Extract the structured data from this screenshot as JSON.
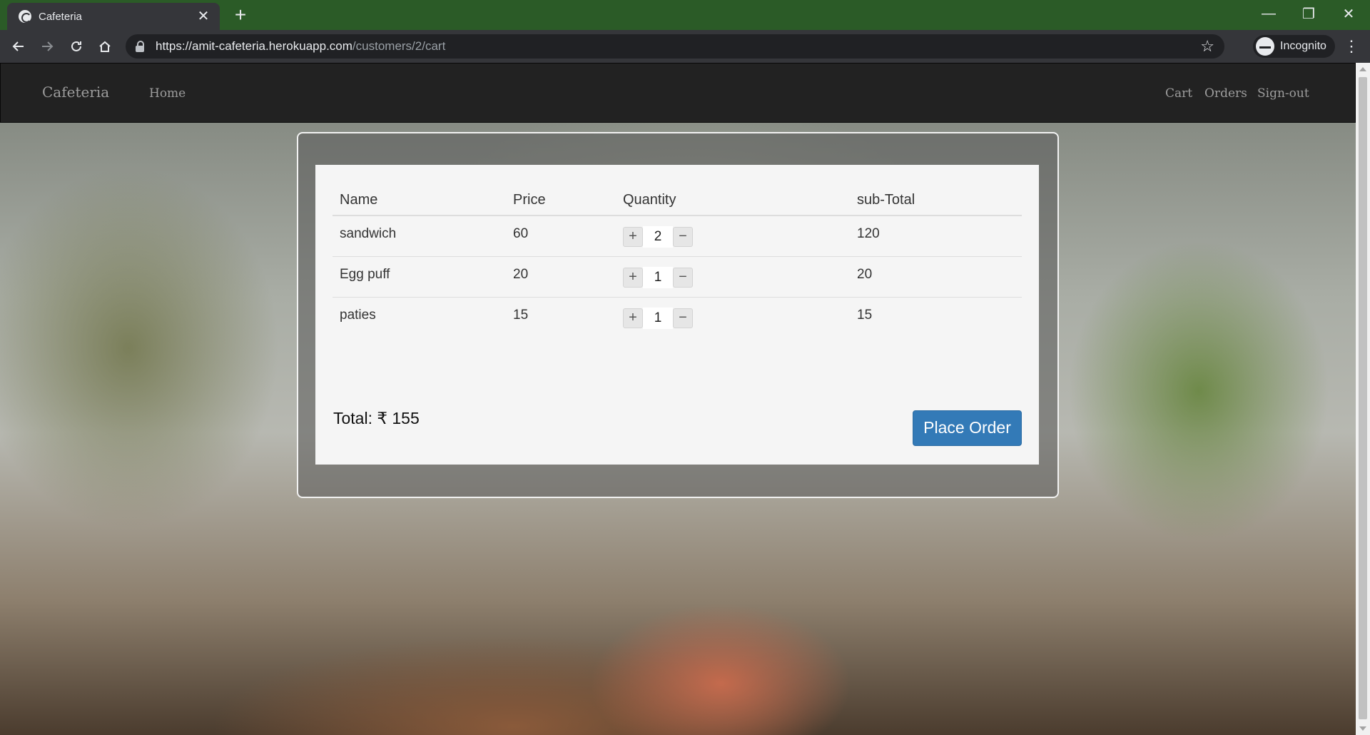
{
  "browser": {
    "tab_title": "Cafeteria",
    "tab_close": "✕",
    "new_tab": "+",
    "url_host": "https://amit-cafeteria.herokuapp.com",
    "url_path": "/customers/2/cart",
    "profile_label": "Incognito",
    "icons": [
      "back-icon",
      "forward-icon",
      "reload-icon",
      "home-icon",
      "lock-icon",
      "star-icon",
      "incognito-icon",
      "menu-icon"
    ],
    "window_controls": {
      "minimize": "—",
      "restore": "❐",
      "close": "✕"
    }
  },
  "navbar": {
    "brand": "Cafeteria",
    "links": {
      "home": "Home",
      "cart": "Cart",
      "orders": "Orders",
      "signout": "Sign-out"
    }
  },
  "cart": {
    "headers": {
      "name": "Name",
      "price": "Price",
      "quantity": "Quantity",
      "subtotal": "sub-Total"
    },
    "items": [
      {
        "name": "sandwich",
        "price": "60",
        "quantity": "2",
        "subtotal": "120"
      },
      {
        "name": "Egg puff",
        "price": "20",
        "quantity": "1",
        "subtotal": "20"
      },
      {
        "name": "paties",
        "price": "15",
        "quantity": "1",
        "subtotal": "15"
      }
    ],
    "increment": "+",
    "decrement": "−",
    "total": "Total: ₹ 155",
    "place_order": "Place Order"
  },
  "colors": {
    "tabstrip": "#2b5b27",
    "navbar": "#222222",
    "primary_button": "#337ab7"
  }
}
